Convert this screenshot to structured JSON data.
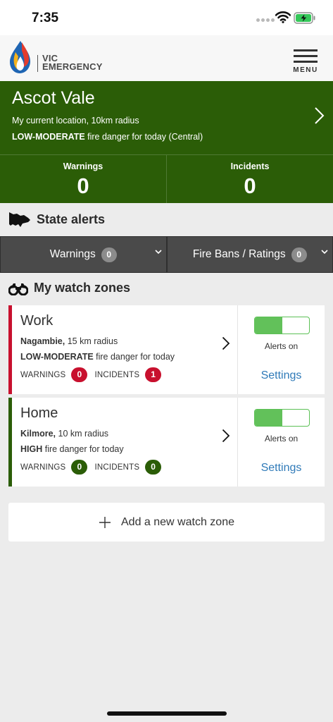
{
  "status_bar": {
    "time": "7:35"
  },
  "header": {
    "logo_line1": "VIC",
    "logo_line2": "EMERGENCY",
    "menu_label": "MENU"
  },
  "location": {
    "title": "Ascot Vale",
    "subtitle": "My current location, 10km radius",
    "danger_level": "LOW-MODERATE",
    "danger_text": " fire danger for today (Central)",
    "warnings_label": "Warnings",
    "warnings_count": "0",
    "incidents_label": "Incidents",
    "incidents_count": "0",
    "colors": {
      "background": "#2b5d07"
    }
  },
  "state_alerts": {
    "title": "State alerts",
    "tabs": [
      {
        "label": "Warnings",
        "count": "0"
      },
      {
        "label": "Fire Bans / Ratings",
        "count": "0"
      }
    ]
  },
  "watch_zones": {
    "title": "My watch zones",
    "zones": [
      {
        "name": "Work",
        "place": "Nagambie,",
        "radius": " 15 km radius",
        "danger_level": "LOW-MODERATE",
        "danger_text": " fire danger for today",
        "warnings_label": "WARNINGS",
        "warnings_count": "0",
        "incidents_label": "INCIDENTS",
        "incidents_count": "1",
        "alerts_status": "Alerts on",
        "alerts_enabled": true,
        "settings_label": "Settings",
        "accent_color": "#c8102e"
      },
      {
        "name": "Home",
        "place": "Kilmore,",
        "radius": " 10 km radius",
        "danger_level": "HIGH",
        "danger_text": " fire danger for today",
        "warnings_label": "WARNINGS",
        "warnings_count": "0",
        "incidents_label": "INCIDENTS",
        "incidents_count": "0",
        "alerts_status": "Alerts on",
        "alerts_enabled": true,
        "settings_label": "Settings",
        "accent_color": "#2b5d07"
      }
    ],
    "add_label": "Add a new watch zone"
  }
}
